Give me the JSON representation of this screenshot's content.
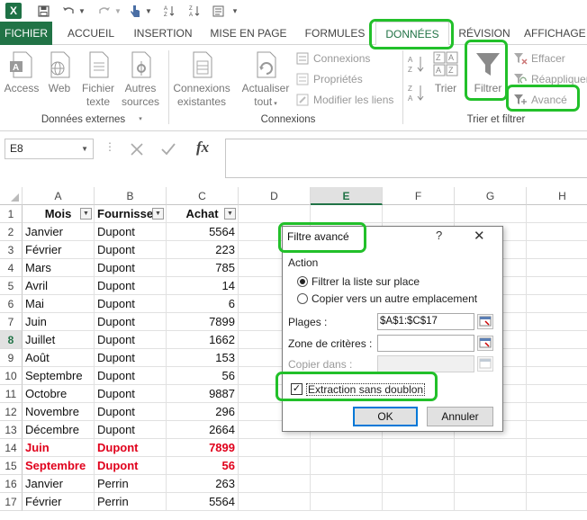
{
  "app": {
    "logo_letter": "X"
  },
  "tabs": [
    {
      "id": "fichier",
      "label": "FICHIER"
    },
    {
      "id": "accueil",
      "label": "ACCUEIL"
    },
    {
      "id": "insertion",
      "label": "INSERTION"
    },
    {
      "id": "mise",
      "label": "MISE EN PAGE"
    },
    {
      "id": "formules",
      "label": "FORMULES"
    },
    {
      "id": "donnees",
      "label": "DONNÉES"
    },
    {
      "id": "revision",
      "label": "RÉVISION"
    },
    {
      "id": "affichage",
      "label": "AFFICHAGE"
    }
  ],
  "ribbon": {
    "ext": {
      "access": "Access",
      "web": "Web",
      "fichier_texte_1": "Fichier",
      "fichier_texte_2": "texte",
      "autres_1": "Autres",
      "autres_2": "sources",
      "group": "Données externes"
    },
    "conn": {
      "existantes_1": "Connexions",
      "existantes_2": "existantes",
      "actualiser_1": "Actualiser",
      "actualiser_2": "tout",
      "connexions": "Connexions",
      "proprietes": "Propriétés",
      "modifier": "Modifier les liens",
      "group": "Connexions"
    },
    "sort": {
      "trier": "Trier",
      "filtrer": "Filtrer",
      "effacer": "Effacer",
      "reappliquer": "Réappliquer",
      "avance": "Avancé",
      "group": "Trier et filtrer"
    }
  },
  "formula_bar": {
    "name_box": "E8",
    "fx": "fx",
    "dots": "⋮"
  },
  "columns": [
    "A",
    "B",
    "C",
    "D",
    "E",
    "F",
    "G",
    "H"
  ],
  "selected_column": "E",
  "selected_row": 8,
  "sheet": {
    "headers": [
      "Mois",
      "Fournisse",
      "Achat"
    ],
    "rows": [
      {
        "n": 2,
        "mois": "Janvier",
        "fournisseur": "Dupont",
        "achat": "5564"
      },
      {
        "n": 3,
        "mois": "Février",
        "fournisseur": "Dupont",
        "achat": "223"
      },
      {
        "n": 4,
        "mois": "Mars",
        "fournisseur": "Dupont",
        "achat": "785"
      },
      {
        "n": 5,
        "mois": "Avril",
        "fournisseur": "Dupont",
        "achat": "14"
      },
      {
        "n": 6,
        "mois": "Mai",
        "fournisseur": "Dupont",
        "achat": "6"
      },
      {
        "n": 7,
        "mois": "Juin",
        "fournisseur": "Dupont",
        "achat": "7899"
      },
      {
        "n": 8,
        "mois": "Juillet",
        "fournisseur": "Dupont",
        "achat": "1662"
      },
      {
        "n": 9,
        "mois": "Août",
        "fournisseur": "Dupont",
        "achat": "153"
      },
      {
        "n": 10,
        "mois": "Septembre",
        "fournisseur": "Dupont",
        "achat": "56"
      },
      {
        "n": 11,
        "mois": "Octobre",
        "fournisseur": "Dupont",
        "achat": "9887"
      },
      {
        "n": 12,
        "mois": "Novembre",
        "fournisseur": "Dupont",
        "achat": "296"
      },
      {
        "n": 13,
        "mois": "Décembre",
        "fournisseur": "Dupont",
        "achat": "2664"
      },
      {
        "n": 14,
        "mois": "Juin",
        "fournisseur": "Dupont",
        "achat": "7899",
        "duplicate": true
      },
      {
        "n": 15,
        "mois": "Septembre",
        "fournisseur": "Dupont",
        "achat": "56",
        "duplicate": true
      },
      {
        "n": 16,
        "mois": "Janvier",
        "fournisseur": "Perrin",
        "achat": "263"
      },
      {
        "n": 17,
        "mois": "Février",
        "fournisseur": "Perrin",
        "achat": "5564"
      }
    ]
  },
  "dialog": {
    "title": "Filtre avancé",
    "help": "?",
    "close": "✕",
    "action_label": "Action",
    "option_inplace": "Filtrer la liste sur place",
    "option_copy": "Copier vers un autre emplacement",
    "plages_label": "Plages :",
    "plages_value": "$A$1:$C$17",
    "criteres_label": "Zone de critères :",
    "criteres_value": "",
    "copier_label": "Copier dans :",
    "copier_value": "",
    "unique_label": "Extraction sans doublon",
    "unique_checked": true,
    "ok": "OK",
    "cancel": "Annuler"
  },
  "colors": {
    "excel_green": "#217346",
    "duplicate_red": "#e0001b",
    "highlight_green": "#22c02a"
  }
}
